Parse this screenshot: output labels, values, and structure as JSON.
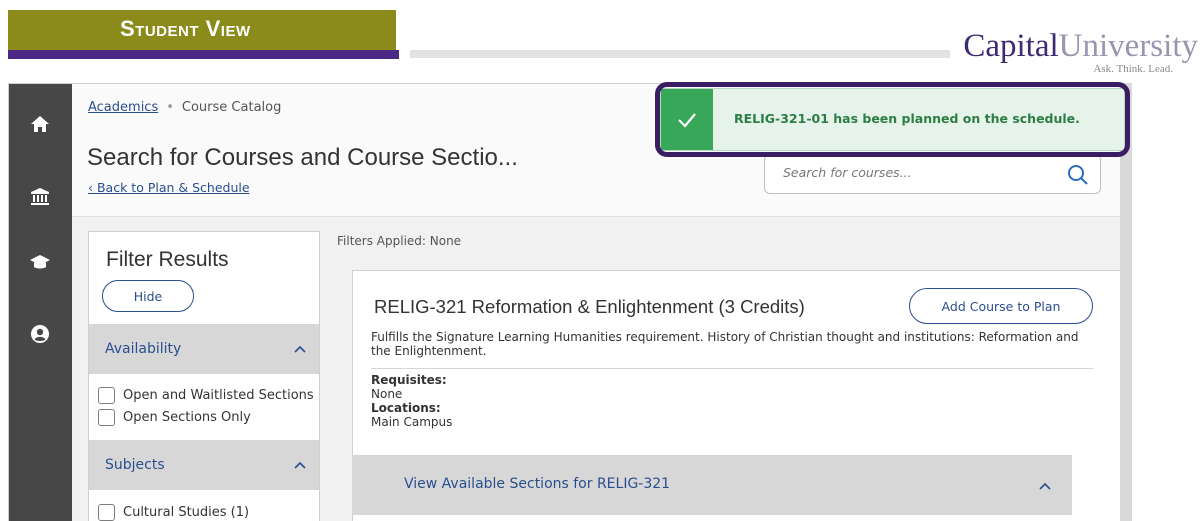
{
  "header": {
    "student_view": "Student View",
    "logo_capital": "Capital",
    "logo_university": "University",
    "logo_tagline": "Ask. Think. Lead."
  },
  "nav": {
    "items": [
      {
        "name": "home",
        "icon": "home-icon"
      },
      {
        "name": "academics",
        "icon": "institution-icon"
      },
      {
        "name": "student",
        "icon": "graduation-cap-icon"
      },
      {
        "name": "profile",
        "icon": "user-circle-icon"
      }
    ]
  },
  "breadcrumb": {
    "link": "Academics",
    "separator": "•",
    "current": "Course Catalog"
  },
  "page": {
    "title": "Search for Courses and Course Sectio...",
    "back_link": "Back to Plan & Schedule"
  },
  "search": {
    "placeholder": "Search for courses...",
    "value": ""
  },
  "toast": {
    "message": "RELIG-321-01 has been planned on the schedule.",
    "icon": "check-icon"
  },
  "filter": {
    "title": "Filter Results",
    "hide_label": "Hide",
    "availability": {
      "label": "Availability",
      "options": [
        "Open and Waitlisted Sections",
        "Open Sections Only"
      ]
    },
    "subjects": {
      "label": "Subjects",
      "options": [
        "Cultural Studies (1)"
      ]
    }
  },
  "results": {
    "filters_applied": "Filters Applied: None",
    "course": {
      "title": "RELIG-321 Reformation & Enlightenment (3 Credits)",
      "add_button": "Add Course to Plan",
      "description": "Fulfills the Signature Learning Humanities requirement. History of Christian thought and institutions: Reformation and the Enlightenment.",
      "requisites_label": "Requisites:",
      "requisites_value": "None",
      "locations_label": "Locations:",
      "locations_value": "Main Campus",
      "sections_label": "View Available Sections for RELIG-321"
    }
  },
  "colors": {
    "brand_purple": "#4b2883",
    "student_view_olive": "#8b8b1c",
    "link_blue": "#2a4f8f",
    "toast_green": "#39a75a",
    "toast_outline": "#3a1d63"
  }
}
